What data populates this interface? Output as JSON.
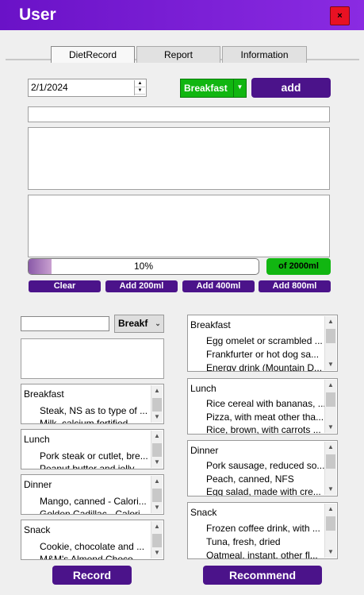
{
  "window": {
    "title": "User",
    "close_glyph": "×"
  },
  "tabs": [
    "DietRecord",
    "Report",
    "Information"
  ],
  "entry": {
    "date_value": "2/1/2024",
    "meal_selected": "Breakfast",
    "add_label": "add",
    "text_value": "",
    "notes1": "",
    "notes2": ""
  },
  "water": {
    "percent": 10,
    "percent_label": "10%",
    "goal_label": "of 2000ml",
    "buttons": [
      "Clear",
      "Add 200ml",
      "Add 400ml",
      "Add 800ml"
    ]
  },
  "search": {
    "value": "",
    "meal_selected": "Breakf"
  },
  "records": {
    "title": "",
    "lists": [
      {
        "name": "Breakfast",
        "items": [
          "Steak, NS as to type of ...",
          "Milk, calcium fortified"
        ]
      },
      {
        "name": "Lunch",
        "items": [
          "Pork steak or cutlet, bre...",
          "Peanut butter and jelly"
        ]
      },
      {
        "name": "Dinner",
        "items": [
          "Mango, canned - Calori...",
          "Golden Cadillac - Calori..."
        ]
      },
      {
        "name": "Snack",
        "items": [
          "Cookie, chocolate and ...",
          "M&M's Almond Choco..."
        ]
      }
    ],
    "button": "Record"
  },
  "recommend": {
    "lists": [
      {
        "name": "Breakfast",
        "items": [
          "Egg omelet or scrambled ...",
          "Frankfurter or hot dog sa...",
          "Energy drink (Mountain D..."
        ]
      },
      {
        "name": "Lunch",
        "items": [
          "Rice cereal with bananas, ...",
          "Pizza, with meat other tha...",
          "Rice, brown, with carrots ..."
        ]
      },
      {
        "name": "Dinner",
        "items": [
          "Pork sausage, reduced so...",
          "Peach, canned, NFS",
          "Egg salad, made with cre..."
        ]
      },
      {
        "name": "Snack",
        "items": [
          "Frozen coffee drink, with ...",
          "Tuna, fresh, dried",
          "Oatmeal, instant, other fl..."
        ]
      }
    ],
    "button": "Recommend"
  },
  "icons": {
    "spin_up": "▲",
    "spin_down": "▼",
    "dropdown": "▼",
    "scroll_up": "▲",
    "scroll_down": "▼"
  },
  "colors": {
    "titlebar": "#7a1fd6",
    "accent_purple": "#4b138a",
    "accent_green": "#11b611",
    "close_red": "#e81123"
  }
}
